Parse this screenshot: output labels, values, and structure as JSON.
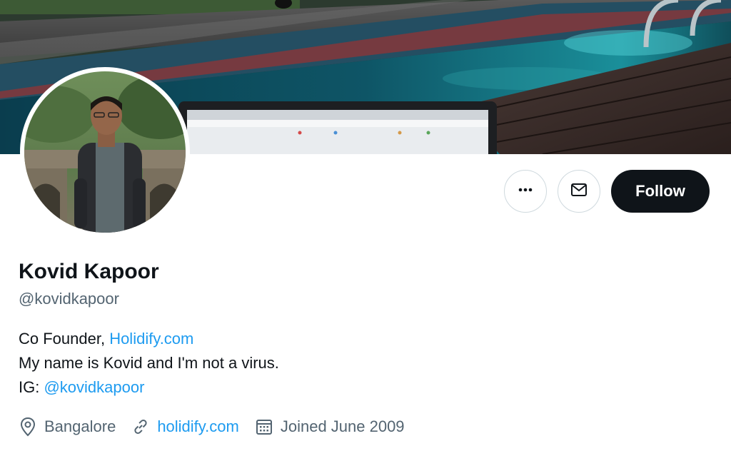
{
  "profile": {
    "name": "Kovid Kapoor",
    "handle": "@kovidkapoor",
    "bio": {
      "line1_prefix": "Co Founder, ",
      "line1_link": "Holidify.com",
      "line2": "My name is Kovid and I'm not a virus.",
      "line3_prefix": "IG: ",
      "line3_link": "@kovidkapoor"
    },
    "location": "Bangalore",
    "website": "holidify.com",
    "joined": "Joined June 2009"
  },
  "actions": {
    "more_icon": "more-horizontal-icon",
    "message_icon": "envelope-icon",
    "follow_label": "Follow"
  },
  "icons": {
    "location": "location-pin-icon",
    "website": "link-icon",
    "joined": "calendar-icon"
  },
  "colors": {
    "text_primary": "#0f1419",
    "text_secondary": "#536471",
    "link": "#1d9bf0",
    "follow_bg": "#0f1419",
    "follow_text": "#ffffff",
    "button_border": "#cfd9de"
  }
}
